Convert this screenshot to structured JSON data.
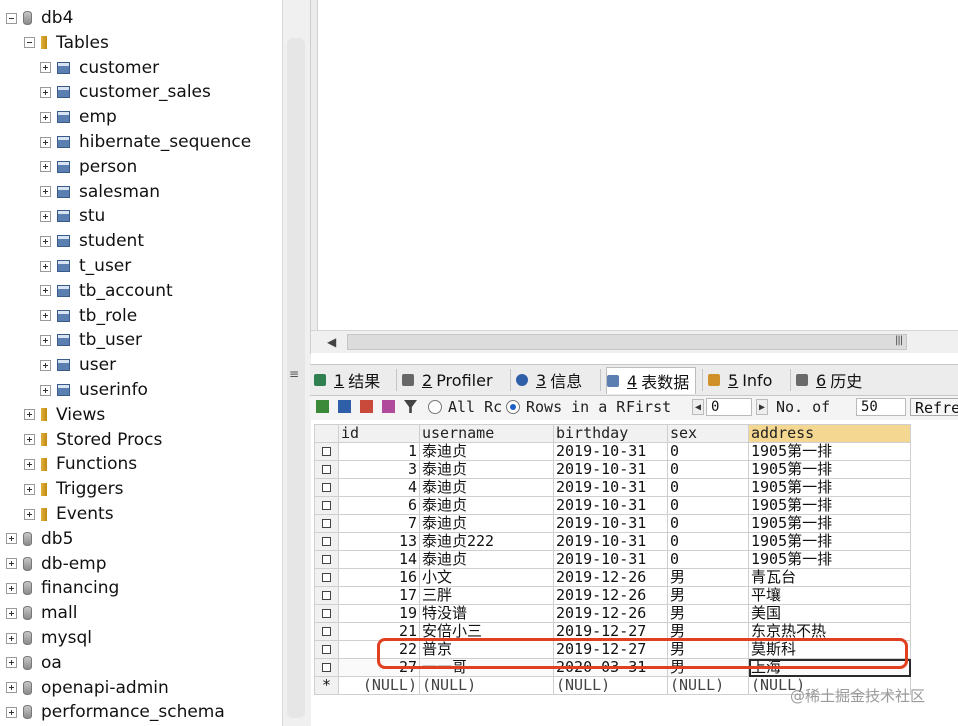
{
  "tree": {
    "nodes": [
      {
        "label": "db4",
        "kind": "db",
        "expander": "minus",
        "level": 0
      },
      {
        "label": "Tables",
        "kind": "folder",
        "expander": "minus",
        "level": 1
      },
      {
        "label": "customer",
        "kind": "table",
        "expander": "plus",
        "level": 2
      },
      {
        "label": "customer_sales",
        "kind": "table",
        "expander": "plus",
        "level": 2
      },
      {
        "label": "emp",
        "kind": "table",
        "expander": "plus",
        "level": 2
      },
      {
        "label": "hibernate_sequence",
        "kind": "table",
        "expander": "plus",
        "level": 2
      },
      {
        "label": "person",
        "kind": "table",
        "expander": "plus",
        "level": 2
      },
      {
        "label": "salesman",
        "kind": "table",
        "expander": "plus",
        "level": 2
      },
      {
        "label": "stu",
        "kind": "table",
        "expander": "plus",
        "level": 2
      },
      {
        "label": "student",
        "kind": "table",
        "expander": "plus",
        "level": 2
      },
      {
        "label": "t_user",
        "kind": "table",
        "expander": "plus",
        "level": 2
      },
      {
        "label": "tb_account",
        "kind": "table",
        "expander": "plus",
        "level": 2
      },
      {
        "label": "tb_role",
        "kind": "table",
        "expander": "plus",
        "level": 2
      },
      {
        "label": "tb_user",
        "kind": "table",
        "expander": "plus",
        "level": 2
      },
      {
        "label": "user",
        "kind": "table",
        "expander": "plus",
        "level": 2
      },
      {
        "label": "userinfo",
        "kind": "table",
        "expander": "plus",
        "level": 2
      },
      {
        "label": "Views",
        "kind": "folder",
        "expander": "plus",
        "level": 1
      },
      {
        "label": "Stored Procs",
        "kind": "folder",
        "expander": "plus",
        "level": 1
      },
      {
        "label": "Functions",
        "kind": "folder",
        "expander": "plus",
        "level": 1
      },
      {
        "label": "Triggers",
        "kind": "folder",
        "expander": "plus",
        "level": 1
      },
      {
        "label": "Events",
        "kind": "folder",
        "expander": "plus",
        "level": 1
      },
      {
        "label": "db5",
        "kind": "db",
        "expander": "plus",
        "level": 0
      },
      {
        "label": "db-emp",
        "kind": "db",
        "expander": "plus",
        "level": 0
      },
      {
        "label": "financing",
        "kind": "db",
        "expander": "plus",
        "level": 0
      },
      {
        "label": "mall",
        "kind": "db",
        "expander": "plus",
        "level": 0
      },
      {
        "label": "mysql",
        "kind": "db",
        "expander": "plus",
        "level": 0
      },
      {
        "label": "oa",
        "kind": "db",
        "expander": "plus",
        "level": 0
      },
      {
        "label": "openapi-admin",
        "kind": "db",
        "expander": "plus",
        "level": 0
      },
      {
        "label": "performance_schema",
        "kind": "db",
        "expander": "plus",
        "level": 0
      }
    ]
  },
  "tabs": [
    {
      "num": "1",
      "label": "结果",
      "icon": "results-icon",
      "active": false
    },
    {
      "num": "2",
      "label": "Profiler",
      "icon": "profiler-icon",
      "active": false
    },
    {
      "num": "3",
      "label": "信息",
      "icon": "info-icon",
      "active": false
    },
    {
      "num": "4",
      "label": "表数据",
      "icon": "table-data-icon",
      "active": true
    },
    {
      "num": "5",
      "label": "Info",
      "icon": "object-info-icon",
      "active": false
    },
    {
      "num": "6",
      "label": "历史",
      "icon": "history-icon",
      "active": false
    }
  ],
  "toolbar": {
    "all_rows_label": "All Rc",
    "rows_in_range_label": "Rows in a R",
    "first_label": "First",
    "first_value": "0",
    "no_of_label": "No. of",
    "no_of_value": "50",
    "refresh_label": "Refresh"
  },
  "grid": {
    "columns": [
      "id",
      "username",
      "birthday",
      "sex",
      "address"
    ],
    "rows": [
      [
        "1",
        "泰迪贞",
        "2019-10-31",
        "0",
        "1905第一排"
      ],
      [
        "3",
        "泰迪贞",
        "2019-10-31",
        "0",
        "1905第一排"
      ],
      [
        "4",
        "泰迪贞",
        "2019-10-31",
        "0",
        "1905第一排"
      ],
      [
        "6",
        "泰迪贞",
        "2019-10-31",
        "0",
        "1905第一排"
      ],
      [
        "7",
        "泰迪贞",
        "2019-10-31",
        "0",
        "1905第一排"
      ],
      [
        "13",
        "泰迪贞222",
        "2019-10-31",
        "0",
        "1905第一排"
      ],
      [
        "14",
        "泰迪贞",
        "2019-10-31",
        "0",
        "1905第一排"
      ],
      [
        "16",
        "小文",
        "2019-12-26",
        "男",
        "青瓦台"
      ],
      [
        "17",
        "三胖",
        "2019-12-26",
        "男",
        "平壤"
      ],
      [
        "19",
        "特没谱",
        "2019-12-26",
        "男",
        "美国"
      ],
      [
        "21",
        "安倍小三",
        "2019-12-27",
        "男",
        "东京热不热"
      ],
      [
        "22",
        "普京",
        "2019-12-27",
        "男",
        "莫斯科"
      ],
      [
        "27",
        "一一哥",
        "2020-03-31",
        "男",
        "上海"
      ]
    ],
    "new_row": [
      "(NULL)",
      "(NULL)",
      "(NULL)",
      "(NULL)",
      "(NULL)"
    ],
    "new_row_marker": "*"
  },
  "colors": {
    "highlight_border": "#e0401f",
    "header_highlight": "#f4d790"
  },
  "watermark": "@稀土掘金技术社区"
}
